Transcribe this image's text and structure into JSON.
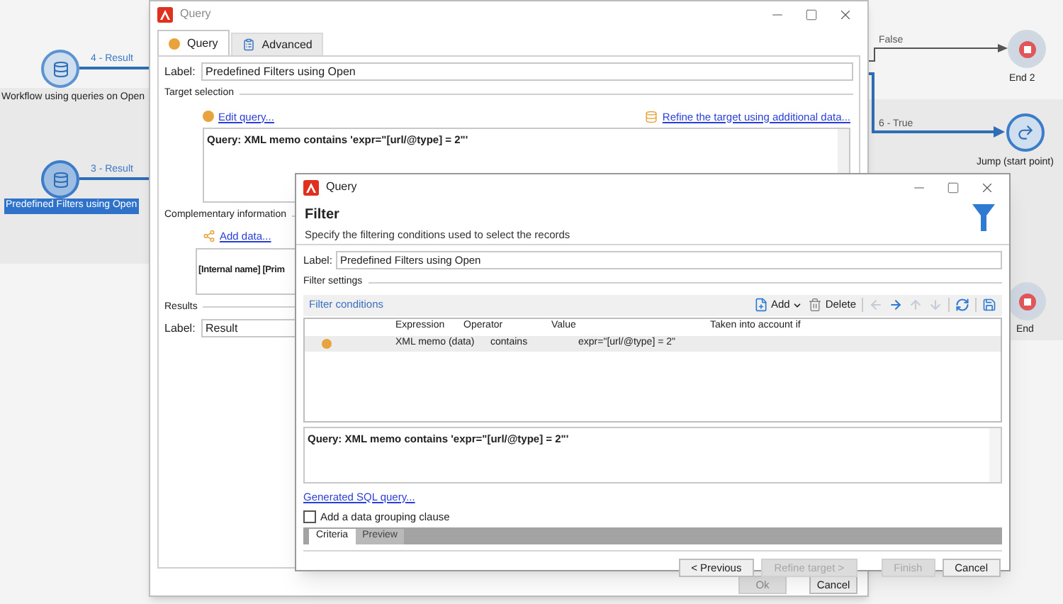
{
  "workflow": {
    "nodes": [
      {
        "kind": "query",
        "label": "Workflow using queries on Open",
        "edge_label": "4 - Result",
        "selected": false
      },
      {
        "kind": "query",
        "label": "Predefined Filters using Open",
        "edge_label": "3 - Result",
        "selected": true
      },
      {
        "kind": "end",
        "label": "End 2",
        "edge_label": "False",
        "selected": false
      },
      {
        "kind": "jump",
        "label": "Jump (start point)",
        "edge_label": "6 - True",
        "selected": false
      },
      {
        "kind": "end",
        "label": "End",
        "selected": false
      }
    ]
  },
  "query_window": {
    "title": "Query",
    "tabs": [
      {
        "label": "Query",
        "selected": true
      },
      {
        "label": "Advanced",
        "selected": false
      }
    ],
    "label_field": {
      "label": "Label:",
      "value": "Predefined Filters using Open"
    },
    "target_selection": {
      "title": "Target selection",
      "edit_link": "Edit query...",
      "refine_link": "Refine the target using additional data...",
      "query_text": "Query: XML memo contains 'expr=\"[url/@type] = 2\"'"
    },
    "complementary": {
      "title": "Complementary information",
      "add_link": "Add data...",
      "text": "[Internal name] [Prim"
    },
    "results": {
      "title": "Results",
      "label": "Label:",
      "value": "Result"
    },
    "buttons": [
      {
        "label": "Ok",
        "disabled": true
      },
      {
        "label": "Cancel",
        "disabled": false
      }
    ]
  },
  "filter_window": {
    "title": "Query",
    "heading": "Filter",
    "description": "Specify the filtering conditions used to select the records",
    "label_field": {
      "label": "Label:",
      "value": "Predefined Filters using Open"
    },
    "settings_title": "Filter settings",
    "conditions_title": "Filter conditions",
    "toolbar": [
      {
        "kind": "add",
        "label": "Add",
        "disabled": false
      },
      {
        "kind": "delete",
        "label": "Delete",
        "disabled": false
      },
      {
        "kind": "left",
        "disabled": true
      },
      {
        "kind": "right",
        "disabled": false
      },
      {
        "kind": "up",
        "disabled": true
      },
      {
        "kind": "down",
        "disabled": true
      },
      {
        "kind": "refresh",
        "disabled": false
      },
      {
        "kind": "save",
        "disabled": false
      }
    ],
    "table": {
      "columns": [
        "Expression",
        "Operator",
        "Value",
        "Taken into account if"
      ],
      "rows": [
        {
          "selected": true,
          "cells": [
            "XML memo (data)",
            "contains",
            "expr=\"[url/@type] = 2\""
          ]
        }
      ]
    },
    "query_text": "Query: XML memo contains 'expr=\"[url/@type] = 2\"'",
    "sql_link": "Generated SQL query...",
    "grouping": {
      "label": "Add a data grouping clause",
      "checked": false
    },
    "tabs": [
      {
        "label": "Criteria",
        "selected": true
      },
      {
        "label": "Preview",
        "selected": false
      }
    ],
    "buttons": [
      {
        "label": "< Previous",
        "disabled": false
      },
      {
        "label": "Refine target >",
        "disabled": true
      },
      {
        "label": "Finish",
        "disabled": true
      },
      {
        "label": "Cancel",
        "disabled": false
      }
    ]
  }
}
